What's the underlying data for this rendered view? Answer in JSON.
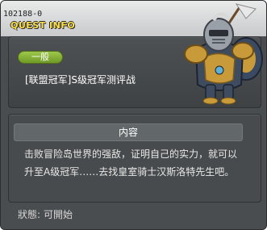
{
  "window": {
    "quest_id": "102188-0",
    "section_title": "QUEST INFO"
  },
  "quest": {
    "category": "一般",
    "name": "[联盟冠军]S级冠军测评战",
    "portrait": "armored-knight-npc-portrait"
  },
  "content": {
    "header": "内容",
    "lines": [
      "击败冒险岛世界的强敌，证明自己的实力，就可以",
      "升至A级冠军……去找皇室骑士汉斯洛特先生吧。"
    ]
  },
  "status": {
    "label": "狀態:",
    "value": "可開始"
  },
  "colors": {
    "window_bg": "#4a4d4f",
    "title_bar": "#d9dadb",
    "quest_info_text": "#ffe046",
    "category_pill": "#8ab83c",
    "content_header_bg": "#62676a"
  }
}
